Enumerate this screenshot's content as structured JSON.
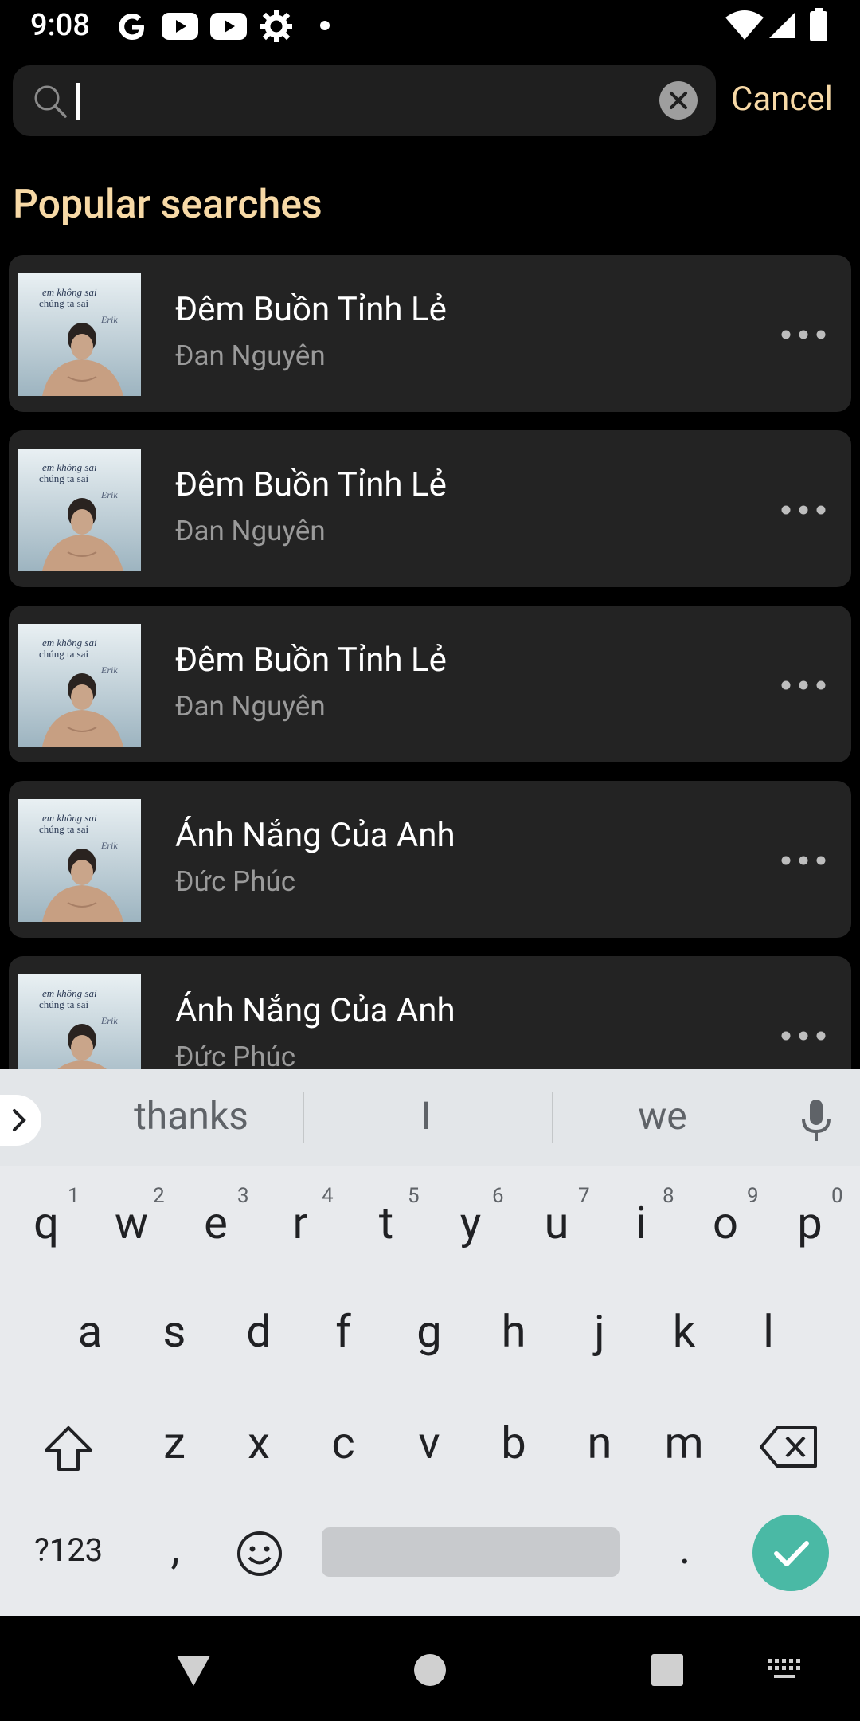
{
  "status_bar": {
    "time": "9:08",
    "left_icons": [
      "google-g-icon",
      "youtube-icon",
      "youtube-icon",
      "settings-gear-icon",
      "dot-icon"
    ],
    "right_icons": [
      "wifi-icon",
      "cellular-signal-icon",
      "battery-icon"
    ]
  },
  "search": {
    "value": "",
    "cancel_label": "Cancel"
  },
  "section_title": "Popular searches",
  "songs": [
    {
      "title": "Đêm Buồn Tỉnh Lẻ",
      "artist": "Đan Nguyên"
    },
    {
      "title": "Đêm Buồn Tỉnh Lẻ",
      "artist": "Đan Nguyên"
    },
    {
      "title": "Đêm Buồn Tỉnh Lẻ",
      "artist": "Đan Nguyên"
    },
    {
      "title": "Ánh Nắng Của Anh",
      "artist": "Đức Phúc"
    },
    {
      "title": "Ánh Nắng Của Anh",
      "artist": "Đức Phúc"
    }
  ],
  "keyboard": {
    "suggestions": [
      "thanks",
      "I",
      "we"
    ],
    "row1": [
      "q",
      "w",
      "e",
      "r",
      "t",
      "y",
      "u",
      "i",
      "o",
      "p"
    ],
    "row1_hints": [
      "1",
      "2",
      "3",
      "4",
      "5",
      "6",
      "7",
      "8",
      "9",
      "0"
    ],
    "row2": [
      "a",
      "s",
      "d",
      "f",
      "g",
      "h",
      "j",
      "k",
      "l"
    ],
    "row3": [
      "z",
      "x",
      "c",
      "v",
      "b",
      "n",
      "m"
    ],
    "symbols_label": "?123",
    "comma": ",",
    "period": "."
  },
  "colors": {
    "accent": "#F7D9A6",
    "card_bg": "#232323",
    "enter_key": "#4AB9A5"
  }
}
